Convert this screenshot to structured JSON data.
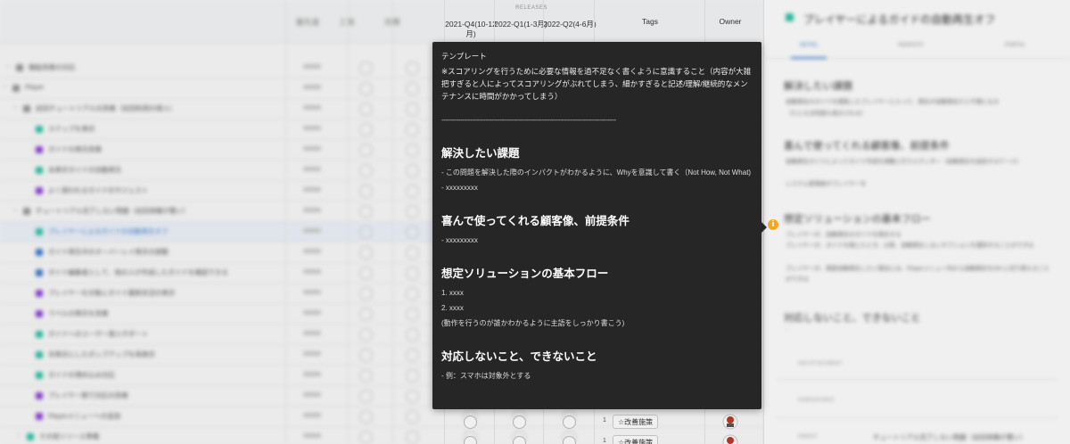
{
  "header": {
    "rank_label": "優先度",
    "effort_label": "工数",
    "impact_label": "効果",
    "releases_label": "RELEASES",
    "releases": [
      "2021-Q4(10-12月)",
      "2022-Q1(1-3月)",
      "2022-Q2(4-6月)"
    ],
    "tags_label": "Tags",
    "owner_label": "Owner"
  },
  "rows": [
    {
      "title": "機能改善の対応",
      "color": "#999999"
    },
    {
      "title": "Player",
      "color": "#999999"
    },
    {
      "title": "初回チュートリアルの改善（初回利用の導入）",
      "color": "#999999"
    },
    {
      "title": "ステップを表示",
      "color": "#2fc3a7"
    },
    {
      "title": "ガイドの表示改善",
      "color": "#8e44d6"
    },
    {
      "title": "未表示ガイドの自動再生",
      "color": "#2fc3a7"
    },
    {
      "title": "よく使われるガイドのサジェスト",
      "color": "#8e44d6"
    },
    {
      "title": "チュートリアル完了しない問題（初回体験が悪い）",
      "color": "#999999"
    },
    {
      "title": "プレイヤーによるガイドの自動再生オフ",
      "color": "#2fc3a7"
    },
    {
      "title": "ガイド再生中のオーバーレイ表示の調整",
      "color": "#3d7ccd"
    },
    {
      "title": "ガイド編集者として、他の人が作成したガイドを確認できる",
      "color": "#3d7ccd"
    },
    {
      "title": "プレイヤーを対象にガイド最新状況の表示",
      "color": "#8e44d6"
    },
    {
      "title": "ラベルの表示を改善",
      "color": "#8e44d6"
    },
    {
      "title": "ガイドへのユーザー導入サポート",
      "color": "#2fc3a7"
    },
    {
      "title": "非表示にしたポップアップを再表示",
      "color": "#2fc3a7"
    },
    {
      "title": "ガイドの埋め込み対応",
      "color": "#2fc3a7"
    },
    {
      "title": "プレイヤー側で対応の改善",
      "color": "#8e44d6"
    },
    {
      "title": "Playerメニューへの追加",
      "color": "#8e44d6"
    },
    {
      "title": "その他リリース準備",
      "color": "#2fc3a7"
    }
  ],
  "tag_rows": [
    {
      "num": "1",
      "tag": "☆改善施策"
    },
    {
      "num": "1",
      "tag": "☆改善施策"
    }
  ],
  "panel": {
    "title": "プレイヤーによるガイドの自動再生オフ",
    "tabs": [
      "DETAIL",
      "INSIGHTS",
      "PORTAL"
    ],
    "sections": [
      {
        "heading": "解決したい課題",
        "lines": [
          "自動再生のガイドを閲覧したプレイヤーにとって、再生が自動再生だと不便になる",
          "（たとえば何度も表示される）"
        ]
      },
      {
        "heading": "喜んで使ってくれる顧客像、前提条件",
        "lines": [
          "自動再生ガイドによってガイド作成を頻繁に行うエディター（自動再生を設定するケース）",
          "システム管理者がプレイヤーを"
        ]
      },
      {
        "heading": "想定ソリューションの基本フロー",
        "lines": [
          "プレイヤーが、自動再生のガイドを再生する",
          "プレイヤーが、ガイドを閉じたとき、以降、自動再生しないオプションを選択することができる",
          "プレイヤーが、再度自動再生したい場合には、Playerメニュー内から自動再生をON に切り替えることができる"
        ]
      },
      {
        "heading": "対応しないこと、できないこと",
        "lines": [
          "-"
        ]
      }
    ],
    "attachment_label": "ADD ATTACHMENT",
    "subfeatures_label": "SUBFEATURES",
    "parent_label": "PARENT",
    "parent_value": "チュートリアル完了しない問題（初回体験が悪い）"
  },
  "tooltip": {
    "head": "テンプレート",
    "intro": "※スコアリングを行うために必要な情報を過不足なく書くように意識すること（内容が大雑把すぎると人によってスコアリングがぶれてしまう、細かすぎると記述/理解/継続的なメンテナンスに時間がかかってしまう）",
    "divider": "------------------------------------------------------------------------------------",
    "sections": [
      {
        "heading": "解決したい課題",
        "paras": [
          "- この問題を解決した際のインパクトがわかるように、Whyを意識して書く（Not How, Not What)",
          "- xxxxxxxxx"
        ]
      },
      {
        "heading": "喜んで使ってくれる顧客像、前提条件",
        "paras": [
          "- xxxxxxxxx"
        ]
      },
      {
        "heading": "想定ソリューションの基本フロー",
        "paras": [
          "1. xxxx",
          "2. xxxx",
          "(動作を行うのが誰かわかるように主語をしっかり書こう)"
        ]
      },
      {
        "heading": "対応しないこと、できないこと",
        "paras": [
          "- 例：スマホは対象外とする"
        ]
      }
    ]
  },
  "colors": {
    "accent": "#3d7ccd",
    "tooltip_bg": "#262626",
    "info": "#f5a623"
  }
}
